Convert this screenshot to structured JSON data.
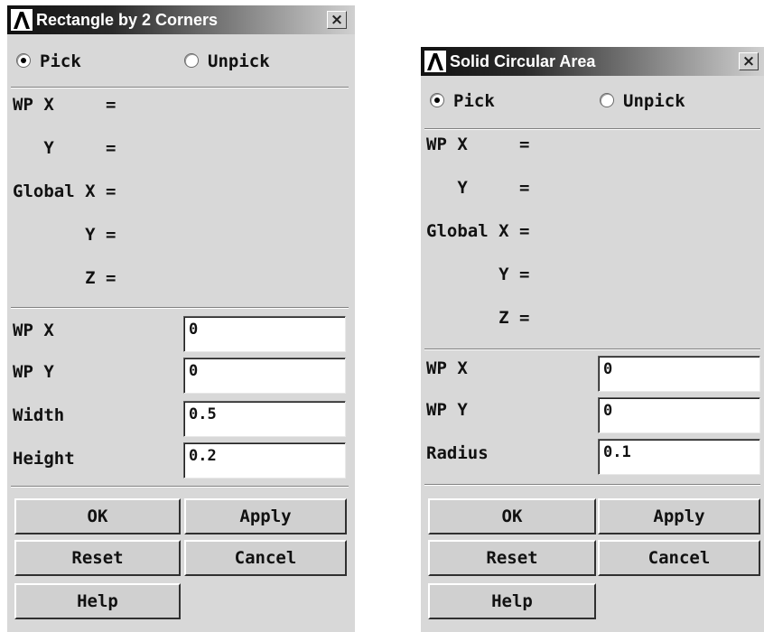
{
  "dialog1": {
    "title": "Rectangle by 2 Corners",
    "close_label": "×",
    "pick_label": "Pick",
    "unpick_label": "Unpick",
    "readouts": {
      "wp_x": "WP X     =",
      "wp_y": "   Y     =",
      "global_x": "Global X =",
      "global_y": "       Y =",
      "global_z": "       Z ="
    },
    "fields": {
      "wp_x_label": "WP X",
      "wp_x_value": "0",
      "wp_y_label": "WP Y",
      "wp_y_value": "0",
      "width_label": "Width",
      "width_value": "0.5",
      "height_label": "Height",
      "height_value": "0.2"
    },
    "buttons": {
      "ok": "OK",
      "apply": "Apply",
      "reset": "Reset",
      "cancel": "Cancel",
      "help": "Help"
    }
  },
  "dialog2": {
    "title": "Solid Circular Area",
    "close_label": "×",
    "pick_label": "Pick",
    "unpick_label": "Unpick",
    "readouts": {
      "wp_x": "WP X     =",
      "wp_y": "   Y     =",
      "global_x": "Global X =",
      "global_y": "       Y =",
      "global_z": "       Z ="
    },
    "fields": {
      "wp_x_label": "WP X",
      "wp_x_value": "0",
      "wp_y_label": "WP Y",
      "wp_y_value": "0",
      "radius_label": "Radius",
      "radius_value": "0.1"
    },
    "buttons": {
      "ok": "OK",
      "apply": "Apply",
      "reset": "Reset",
      "cancel": "Cancel",
      "help": "Help"
    }
  }
}
